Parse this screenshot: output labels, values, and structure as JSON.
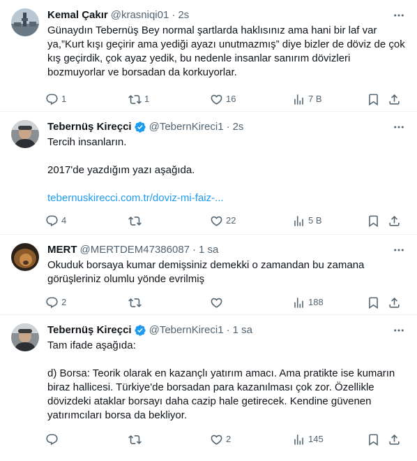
{
  "colors": {
    "text": "#0f1419",
    "secondary": "#536471",
    "link": "#1d9bf0",
    "verified": "#1d9bf0",
    "divider": "#eff3f4"
  },
  "tweets": [
    {
      "name": "Kemal Çakır",
      "handle": "@krasniqi01",
      "time": "2s",
      "verified": false,
      "text": "Günaydın Tebernüş Bey normal şartlarda haklısınız ama hani bir laf var ya,”Kurt kışı geçirir ama yediği ayazı unutmazmış” diye bizler de döviz de çok kış geçirdik, çok ayaz yedik, bu nedenle insanlar sanırım dövizleri bozmuyorlar ve borsadan da korkuyorlar.",
      "replies": "1",
      "retweets": "1",
      "likes": "16",
      "views": "7 B",
      "avatar_icon": "landscape-avatar-icon"
    },
    {
      "name": "Tebernüş Kireçci",
      "handle": "@TebernKireci1",
      "time": "2s",
      "verified": true,
      "text_lines": [
        "Tercih insanların.",
        "",
        "2017'de yazdığım yazı aşağıda.",
        ""
      ],
      "link": "tebernuskirecci.com.tr/doviz-mi-faiz-...",
      "replies": "4",
      "retweets": "",
      "likes": "22",
      "views": "5 B",
      "avatar_icon": "person-avatar-icon"
    },
    {
      "name": "MERT",
      "handle": "@MERTDEM47386087",
      "time": "1 sa",
      "verified": false,
      "text": "Okuduk borsaya kumar demişsiniz demekki o zamandan bu zamana görüşleriniz olumlu yönde evrilmiş",
      "replies": "2",
      "retweets": "",
      "likes": "",
      "views": "188",
      "avatar_icon": "lion-avatar-icon"
    },
    {
      "name": "Tebernüş Kireçci",
      "handle": "@TebernKireci1",
      "time": "1 sa",
      "verified": true,
      "text": "Tam ifade aşağıda:\n\nd) Borsa: Teorik olarak en kazançlı yatırım amacı. Ama pratikte ise kumarın biraz hallicesi. Türkiye'de borsadan para kazanılması çok zor. Özellikle dövizdeki ataklar borsayı daha cazip hale getirecek. Kendine güvenen yatırımcıları borsa da bekliyor.",
      "replies": "",
      "retweets": "",
      "likes": "2",
      "views": "145",
      "avatar_icon": "person-avatar-icon"
    }
  ]
}
